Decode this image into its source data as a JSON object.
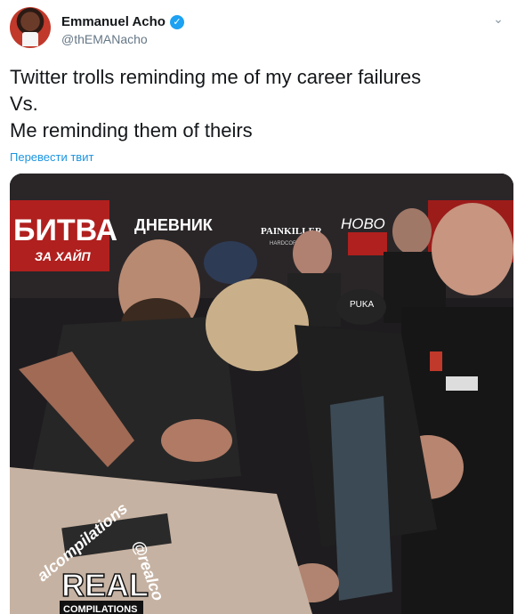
{
  "author": {
    "display_name": "Emmanuel Acho",
    "handle": "@thEMANacho",
    "verified_icon": "verified-badge-icon"
  },
  "tweet": {
    "lines": [
      "Twitter trolls reminding me of my career failures",
      "Vs.",
      "Me reminding them of theirs"
    ],
    "translate_label": "Перевести твит"
  },
  "media": {
    "banner_left": "БИТВА",
    "banner_left_sub": "ЗА ХАЙП",
    "banner_mid": "ДНЕВНИК",
    "banner_brand": "PAINKILLER",
    "banner_brand_sub": "HARDCORE",
    "banner_right": "НОВО",
    "cap_text": "PUKA",
    "watermark_arc_left": "alcompilations",
    "watermark_arc_right": "@realco",
    "watermark_big": "REAL",
    "watermark_small": "COMPILATIONS"
  },
  "colors": {
    "accent": "#1da1f2",
    "link": "#1b95e0",
    "banner_red": "#b0201e"
  }
}
